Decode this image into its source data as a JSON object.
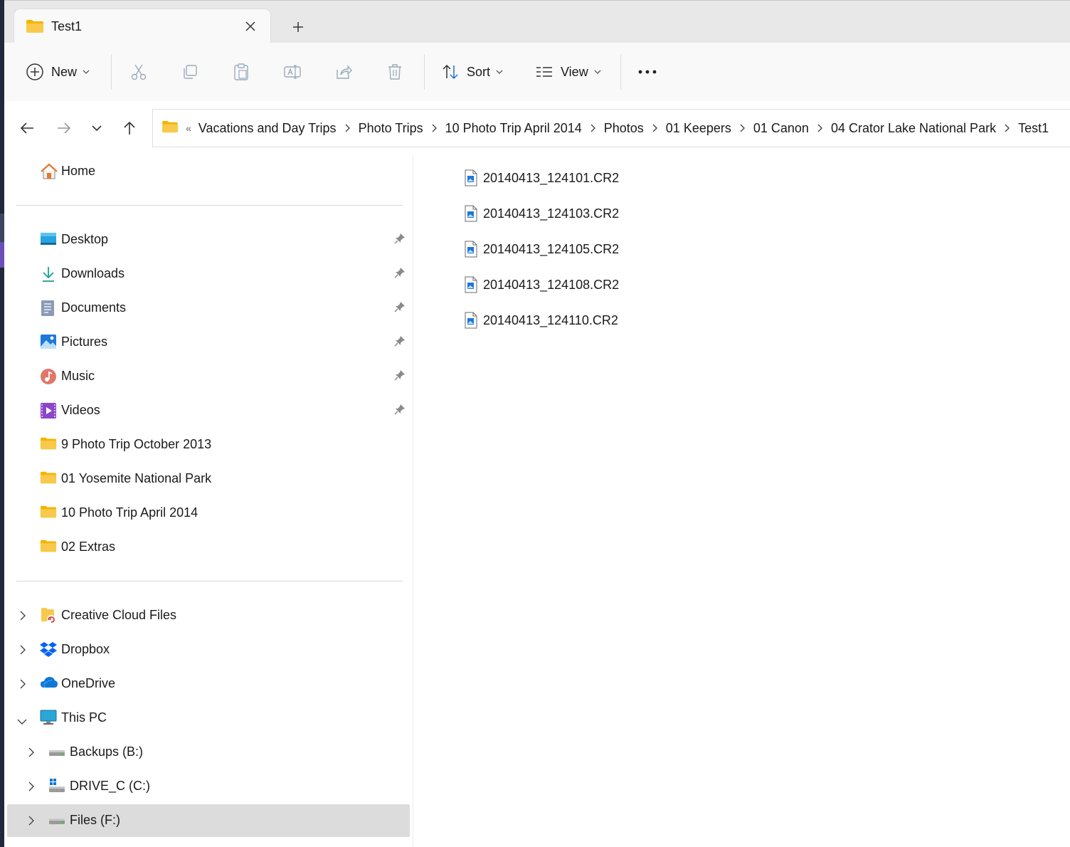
{
  "tab": {
    "title": "Test1"
  },
  "toolbar": {
    "new_label": "New",
    "sort_label": "Sort",
    "view_label": "View"
  },
  "breadcrumb": {
    "items": [
      "Vacations and Day Trips",
      "Photo Trips",
      "10 Photo Trip April 2014",
      "Photos",
      "01 Keepers",
      "01 Canon",
      "04 Crator Lake National Park",
      "Test1"
    ]
  },
  "sidebar": {
    "home": "Home",
    "quick_access": [
      {
        "label": "Desktop",
        "icon": "desktop-icon",
        "pinned": true
      },
      {
        "label": "Downloads",
        "icon": "download-icon",
        "pinned": true
      },
      {
        "label": "Documents",
        "icon": "documents-icon",
        "pinned": true
      },
      {
        "label": "Pictures",
        "icon": "pictures-icon",
        "pinned": true
      },
      {
        "label": "Music",
        "icon": "music-icon",
        "pinned": true
      },
      {
        "label": "Videos",
        "icon": "videos-icon",
        "pinned": true
      },
      {
        "label": "9 Photo Trip October 2013",
        "icon": "folder-icon",
        "pinned": false
      },
      {
        "label": "01 Yosemite National Park",
        "icon": "folder-icon",
        "pinned": false
      },
      {
        "label": "10 Photo Trip April 2014",
        "icon": "folder-icon",
        "pinned": false
      },
      {
        "label": "02 Extras",
        "icon": "folder-icon",
        "pinned": false
      }
    ],
    "locations": [
      {
        "label": "Creative Cloud Files",
        "icon": "creative-cloud-icon",
        "expanded": false
      },
      {
        "label": "Dropbox",
        "icon": "dropbox-icon",
        "expanded": false
      },
      {
        "label": "OneDrive",
        "icon": "onedrive-icon",
        "expanded": false
      },
      {
        "label": "This PC",
        "icon": "computer-icon",
        "expanded": true
      }
    ],
    "drives": [
      {
        "label": "Backups (B:)",
        "icon": "drive-icon",
        "selected": false
      },
      {
        "label": "DRIVE_C (C:)",
        "icon": "system-drive-icon",
        "selected": false
      },
      {
        "label": "Files (F:)",
        "icon": "drive-icon",
        "selected": true
      }
    ]
  },
  "files": [
    "20140413_124101.CR2",
    "20140413_124103.CR2",
    "20140413_124105.CR2",
    "20140413_124108.CR2",
    "20140413_124110.CR2"
  ],
  "colors": {
    "folder": "#f8c94a",
    "selected_bg": "#dcdcdc",
    "accent_blue": "#1e6fd9"
  }
}
